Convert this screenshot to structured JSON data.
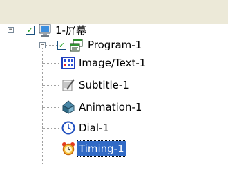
{
  "tree": {
    "root": {
      "label": "1-屏幕",
      "icon": "monitor-icon",
      "checked": true,
      "expanded": true
    },
    "program": {
      "label": "Program-1",
      "icon": "program-window-icon",
      "checked": true,
      "expanded": true
    },
    "children": [
      {
        "label": "Image/Text-1",
        "icon": "image-text-icon"
      },
      {
        "label": "Subtitle-1",
        "icon": "subtitle-icon"
      },
      {
        "label": "Animation-1",
        "icon": "animation-icon"
      },
      {
        "label": "Dial-1",
        "icon": "dial-clock-icon"
      },
      {
        "label": "Timing-1",
        "icon": "alarm-clock-icon",
        "selected": true
      }
    ],
    "expander_minus": "−",
    "check_mark": "✓"
  }
}
